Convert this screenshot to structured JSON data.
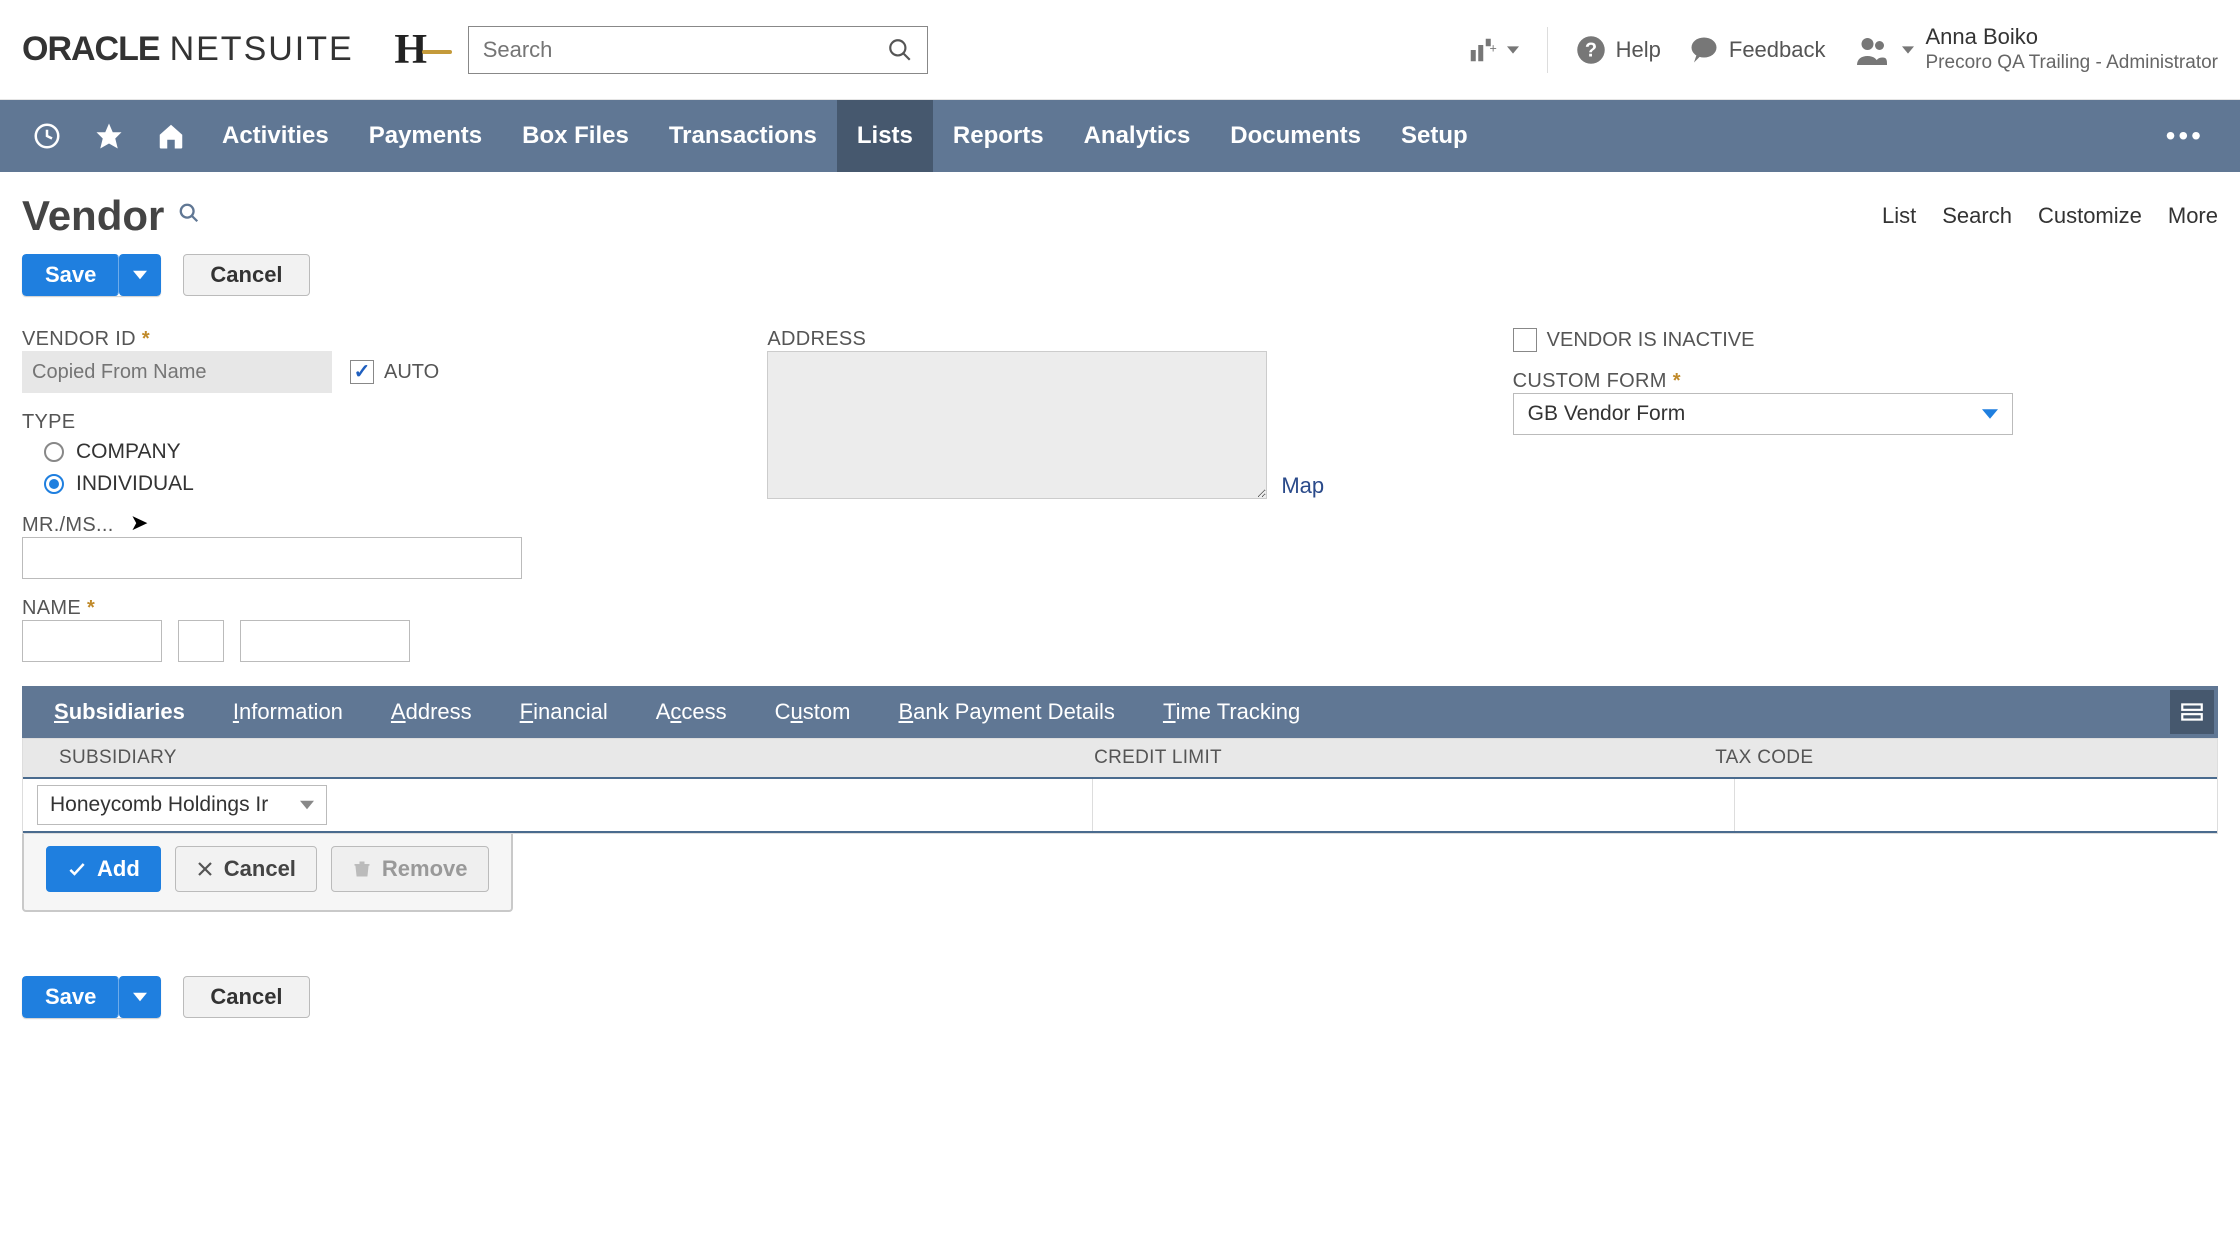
{
  "header": {
    "logo_oracle": "ORACLE",
    "logo_netsuite": "NETSUITE",
    "company_glyph": "H",
    "search_placeholder": "Search",
    "help": "Help",
    "feedback": "Feedback",
    "user_name": "Anna Boiko",
    "user_role": "Precoro QA Trailing - Administrator"
  },
  "nav": {
    "items": [
      "Activities",
      "Payments",
      "Box Files",
      "Transactions",
      "Lists",
      "Reports",
      "Analytics",
      "Documents",
      "Setup"
    ],
    "active": "Lists"
  },
  "page": {
    "title": "Vendor",
    "actions": [
      "List",
      "Search",
      "Customize",
      "More"
    ],
    "save_label": "Save",
    "cancel_label": "Cancel"
  },
  "form": {
    "vendor_id_label": "VENDOR ID",
    "vendor_id_placeholder": "Copied From Name",
    "auto_label": "AUTO",
    "type_label": "TYPE",
    "type_company": "COMPANY",
    "type_individual": "INDIVIDUAL",
    "salutation_label": "MR./MS...",
    "name_label": "NAME",
    "address_label": "ADDRESS",
    "map_label": "Map",
    "inactive_label": "VENDOR IS INACTIVE",
    "custom_form_label": "CUSTOM FORM",
    "custom_form_value": "GB Vendor Form"
  },
  "subtabs": {
    "items": [
      "Subsidiaries",
      "Information",
      "Address",
      "Financial",
      "Access",
      "Custom",
      "Bank Payment Details",
      "Time Tracking"
    ],
    "active": "Subsidiaries"
  },
  "sublist": {
    "columns": [
      "SUBSIDIARY",
      "CREDIT LIMIT",
      "TAX CODE"
    ],
    "subsidiary_value": "Honeycomb Holdings Ir",
    "add_label": "Add",
    "cancel_label": "Cancel",
    "remove_label": "Remove"
  }
}
